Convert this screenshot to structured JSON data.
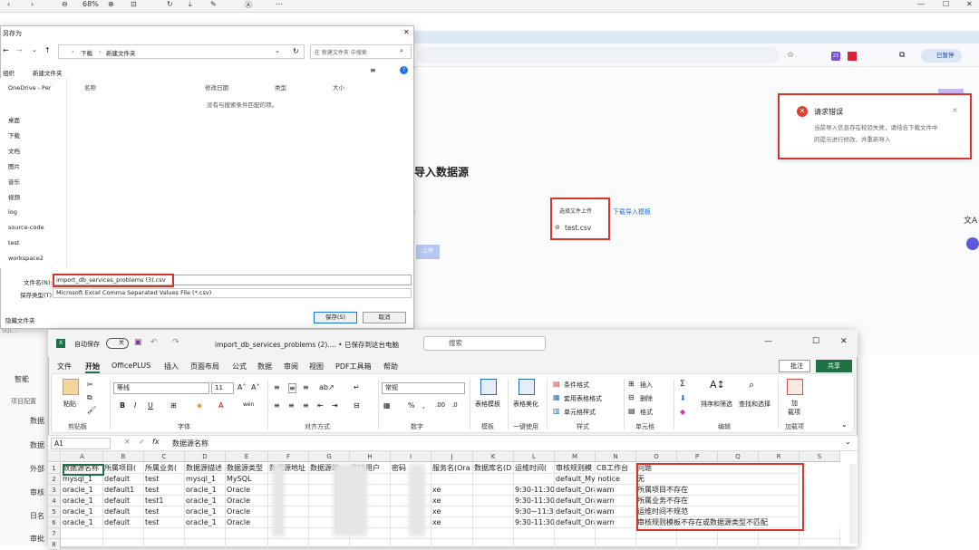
{
  "pdf_toolbar": {
    "zoom": "68%"
  },
  "browser": {
    "pause_label": "已暂停",
    "badge": "23",
    "page_heading": "导入数据源",
    "error": {
      "title": "请求错误",
      "message_line1": "当前导入信息存在校验失败，请结合下载文件中",
      "message_line2": "的提示进行修改，并重新导入"
    },
    "upload": {
      "button": "选择文件上传",
      "file": "test.csv",
      "template_link": "下载导入模板"
    },
    "confirm_btn": "上传"
  },
  "app_sidebar": {
    "items": [
      "SQL...",
      "智能",
      "项目配置",
      "数据",
      "数据",
      "外部",
      "审核",
      "日名",
      "审批"
    ]
  },
  "save_dialog": {
    "title": "另存为",
    "path": [
      "下载",
      "新建文件夹"
    ],
    "search_placeholder": "在 新建文件夹 中搜索",
    "organize": "组织",
    "new_folder": "新建文件夹",
    "columns": [
      "名称",
      "修改日期",
      "类型",
      "大小"
    ],
    "empty_text": "没有与搜索条件匹配的项。",
    "tree": [
      "OneDrive - Per",
      "桌面",
      "下载",
      "文档",
      "图片",
      "音乐",
      "视频",
      "log",
      "source-code",
      "test",
      "workspace2"
    ],
    "filename_label": "文件名(N):",
    "filename": "import_db_services_problems (3).csv",
    "filetype_label": "保存类型(T):",
    "filetype": "Microsoft Excel Comma Separated Values File (*.csv)",
    "hide_folders": "隐藏文件夹",
    "save_btn": "保存(S)",
    "cancel_btn": "取消"
  },
  "excel": {
    "autosave_label": "自动保存",
    "autosave_state": "关",
    "doc_title": "import_db_services_problems (2)....  • 已保存到这台电脑",
    "search": "搜索",
    "menu": [
      "文件",
      "开始",
      "OfficePLUS",
      "插入",
      "页面布局",
      "公式",
      "数据",
      "审阅",
      "视图",
      "PDF工具箱",
      "帮助"
    ],
    "comment_btn": "批注",
    "share_btn": "共享",
    "font_name": "等线",
    "font_size": "11",
    "number_format": "常规",
    "ribbon_groups": [
      "剪贴板",
      "字体",
      "对齐方式",
      "数字",
      "模板",
      "一键使用",
      "样式",
      "单元格",
      "编辑",
      "加载项"
    ],
    "ribbon_items": {
      "paste": "粘贴",
      "template_tbl": "表格模板",
      "beautify": "表格美化",
      "cond_fmt": "条件格式",
      "table_fmt": "套用表格格式",
      "cell_style": "单元格样式",
      "insert": "插入",
      "delete": "删除",
      "format": "格式",
      "sort_filter": "排序和筛选",
      "find_select": "查找和选择",
      "addins_line1": "加",
      "addins_line2": "载项"
    },
    "name_box": "A1",
    "formula": "数据源名称",
    "columns": [
      "A",
      "B",
      "C",
      "D",
      "E",
      "F",
      "G",
      "H",
      "I",
      "J",
      "K",
      "L",
      "M",
      "N",
      "O",
      "P",
      "Q",
      "R",
      "S"
    ],
    "rows": [
      [
        "数据源名称",
        "所属项目(",
        "所属业务(",
        "数据源描述",
        "数据源类型",
        "数据源地址",
        "数据源端",
        "连接用户",
        "密码",
        "服务名(Ora",
        "数据库名(D",
        "运维时间(",
        "审核规则模",
        "CB工作台",
        "问题"
      ],
      [
        "mysql_1",
        "default",
        "test",
        "mysql_1",
        "MySQL",
        "",
        "",
        "",
        "",
        "",
        "",
        "",
        "",
        "",
        "无"
      ],
      [
        "oracle_1",
        "default1",
        "test",
        "oracle_1",
        "Oracle",
        "",
        "",
        "",
        "",
        "xe",
        "",
        "9:30-11:30,",
        "default_Ora",
        "warn",
        "所属项目不存在"
      ],
      [
        "oracle_1",
        "default",
        "test1",
        "oracle_1",
        "Oracle",
        "",
        "",
        "",
        "",
        "xe",
        "",
        "9:30-11:30,",
        "default_Ora",
        "warn",
        "所属业务不存在"
      ],
      [
        "oracle_1",
        "default",
        "test",
        "oracle_1",
        "Oracle",
        "",
        "",
        "",
        "",
        "xe",
        "",
        "9:30~11:30,",
        "default_Ora",
        "warn",
        "运维时间不规范"
      ],
      [
        "oracle_1",
        "default",
        "test",
        "oracle_1",
        "Oracle",
        "",
        "",
        "",
        "",
        "xe",
        "",
        "9:30-11:30,",
        "default_Ora",
        "warn",
        "审核规则模板不存在或数据源类型不匹配"
      ]
    ],
    "row_numbers": [
      "1",
      "2",
      "3",
      "4",
      "5",
      "6",
      "7",
      "8"
    ],
    "row2_extra": "default_My notice"
  },
  "colors": {
    "error_red": "#d9342b",
    "excel_green": "#1e7145",
    "link_blue": "#1a73e8"
  }
}
